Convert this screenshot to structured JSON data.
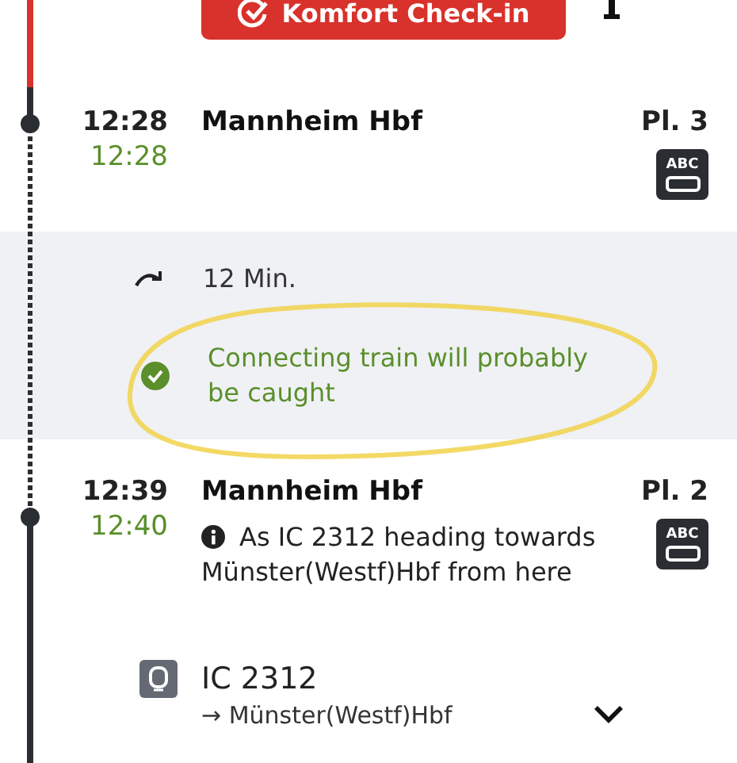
{
  "checkin_button": {
    "label": "Komfort Check-in"
  },
  "stops": [
    {
      "planned_time": "12:28",
      "actual_time": "12:28",
      "station": "Mannheim Hbf",
      "platform": "Pl. 3",
      "coach_icon_label": "ABC"
    },
    {
      "planned_time": "12:39",
      "actual_time": "12:40",
      "station": "Mannheim Hbf",
      "platform": "Pl. 2",
      "coach_icon_label": "ABC",
      "note": "As IC 2312 heading towards Münster(Westf)Hbf from here"
    }
  ],
  "transfer": {
    "duration": "12 Min.",
    "status": "Connecting train will probably be caught",
    "status_ok": true
  },
  "train": {
    "name": "IC 2312",
    "direction": "→ Münster(Westf)Hbf",
    "expanded": false
  }
}
